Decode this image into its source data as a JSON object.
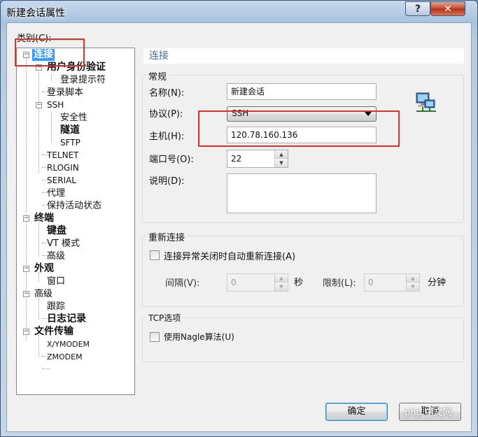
{
  "window": {
    "title": "新建会话属性",
    "help": "?",
    "close": "✕"
  },
  "category_label": "类别(C):",
  "tree": [
    {
      "label": "连接",
      "bold": true,
      "selected": true
    },
    {
      "label": "用户身份验证",
      "bold": true
    },
    {
      "label": "登录提示符"
    },
    {
      "label": "登录脚本"
    },
    {
      "label": "SSH"
    },
    {
      "label": "安全性"
    },
    {
      "label": "隧道",
      "bold": true
    },
    {
      "label": "SFTP"
    },
    {
      "label": "TELNET"
    },
    {
      "label": "RLOGIN"
    },
    {
      "label": "SERIAL"
    },
    {
      "label": "代理"
    },
    {
      "label": "保持活动状态"
    },
    {
      "label": "终端",
      "bold": true
    },
    {
      "label": "键盘",
      "bold": true
    },
    {
      "label": "VT 模式"
    },
    {
      "label": "高级"
    },
    {
      "label": "外观",
      "bold": true
    },
    {
      "label": "窗口"
    },
    {
      "label": "高级"
    },
    {
      "label": "跟踪"
    },
    {
      "label": "日志记录",
      "bold": true
    },
    {
      "label": "文件传输",
      "bold": true
    },
    {
      "label": "X/YMODEM"
    },
    {
      "label": "ZMODEM"
    }
  ],
  "panel": {
    "header": "连接",
    "general": {
      "title": "常规",
      "name_label": "名称(N):",
      "name_value": "新建会话",
      "protocol_label": "协议(P):",
      "protocol_value": "SSH",
      "host_label": "主机(H):",
      "host_value": "120.78.160.136",
      "port_label": "端口号(O):",
      "port_value": "22",
      "desc_label": "说明(D):",
      "desc_value": ""
    },
    "reconnect": {
      "title": "重新连接",
      "auto_label": "连接异常关闭时自动重新连接(A)",
      "interval_label": "间隔(V):",
      "interval_value": "0",
      "interval_unit": "秒",
      "limit_label": "限制(L):",
      "limit_value": "0",
      "limit_unit": "分钟"
    },
    "tcp": {
      "title": "TCP选项",
      "nagle_label": "使用Nagle算法(U)"
    }
  },
  "buttons": {
    "ok": "确定",
    "cancel": "取消"
  },
  "watermark": "php 中文网",
  "colors": {
    "selection": "#3399ff",
    "annotation_red": "#e0302a"
  }
}
